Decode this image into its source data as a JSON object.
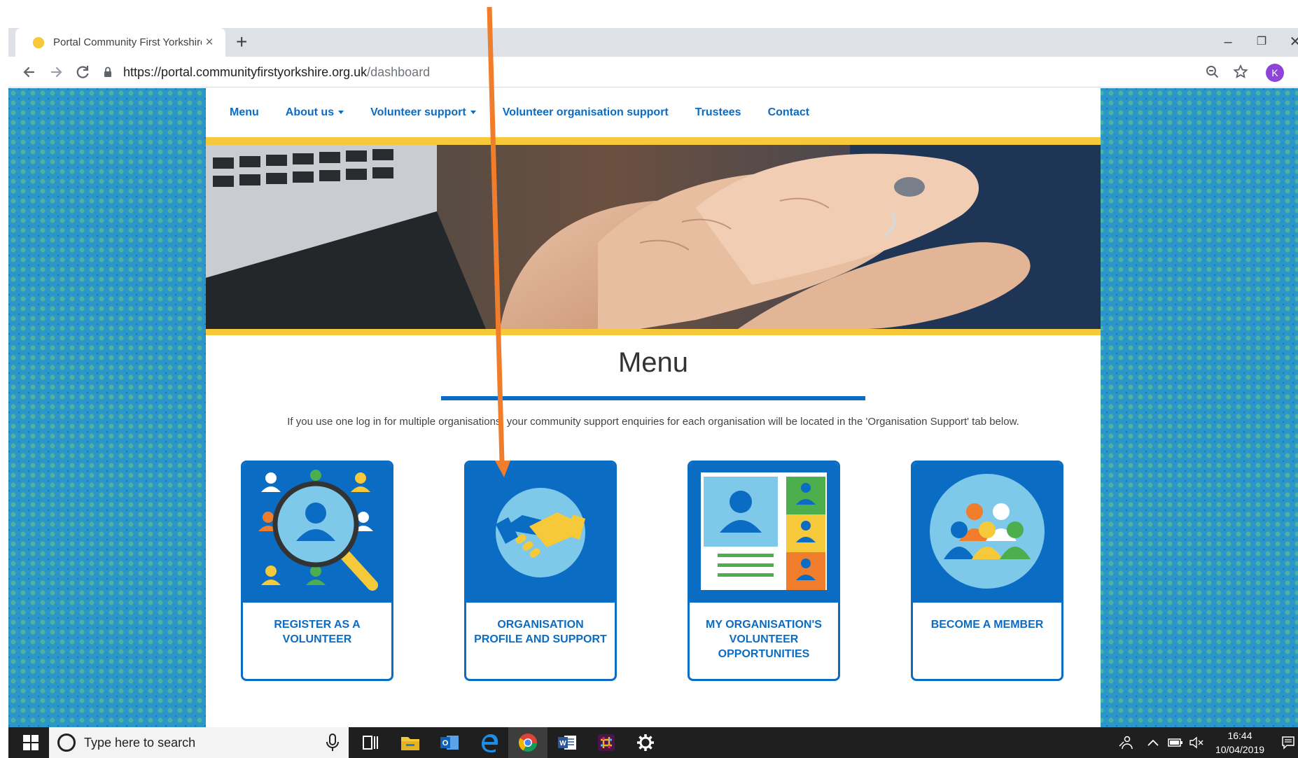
{
  "browser": {
    "tab_title": "Portal Community First Yorkshire",
    "tab_close": "×",
    "new_tab": "+",
    "window_controls": {
      "minimize": "–",
      "restore": "❐",
      "close": "✕"
    },
    "url_host": "https://portal.communityfirstyorkshire.org.uk",
    "url_path": "/dashboard",
    "profile_initial": "K",
    "icons": [
      "back-arrow-icon",
      "forward-arrow-icon",
      "reload-icon",
      "lock-icon",
      "zoom-icon",
      "star-icon"
    ]
  },
  "site_nav": {
    "items": [
      {
        "label": "Menu",
        "dropdown": false
      },
      {
        "label": "About us",
        "dropdown": true
      },
      {
        "label": "Volunteer support",
        "dropdown": true
      },
      {
        "label": "Volunteer organisation support",
        "dropdown": false
      },
      {
        "label": "Trustees",
        "dropdown": false
      },
      {
        "label": "Contact",
        "dropdown": false
      }
    ]
  },
  "main": {
    "heading": "Menu",
    "intro": "If you use one log in for multiple organisations, your community support enquiries for each organisation will be located in the 'Organisation Support' tab below.",
    "cards": [
      {
        "label": "REGISTER AS A VOLUNTEER",
        "icon": "volunteer-search-icon"
      },
      {
        "label": "ORGANISATION PROFILE AND SUPPORT",
        "icon": "handshake-icon"
      },
      {
        "label": "MY ORGANISATION'S VOLUNTEER OPPORTUNITIES",
        "icon": "profile-opportunities-icon"
      },
      {
        "label": "BECOME A MEMBER",
        "icon": "group-members-icon"
      }
    ]
  },
  "colors": {
    "brand_blue": "#0b6cc4",
    "accent_yellow": "#f5c93a",
    "arrow_orange": "#f07d2b",
    "background_teal": "#2a96c9"
  },
  "taskbar": {
    "search_placeholder": "Type here to search",
    "time": "16:44",
    "date": "10/04/2019"
  }
}
